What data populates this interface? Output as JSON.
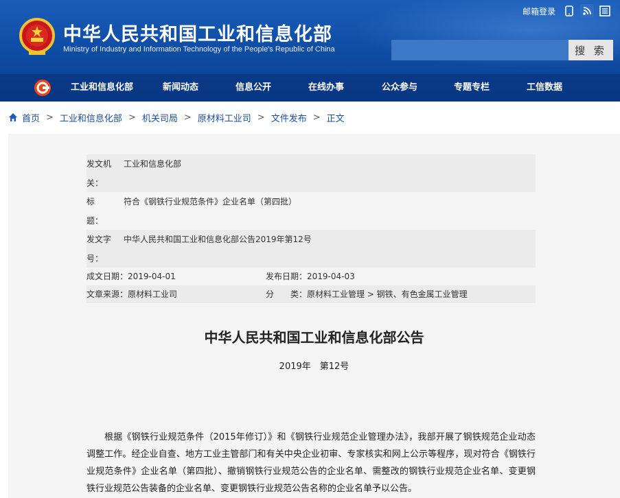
{
  "header": {
    "title": "中华人民共和国工业和信息化部",
    "subtitle": "Ministry of Industry and Information Technology of the People's Republic of China",
    "mail_login": "邮箱登录",
    "search": {
      "placeholder": "",
      "button": "搜 索"
    },
    "icons": [
      "mobile-icon",
      "rss-icon",
      "news-icon"
    ]
  },
  "nav": {
    "items": [
      "工业和信息化部",
      "新闻动态",
      "信息公开",
      "在线办事",
      "公众参与",
      "专题专栏",
      "工信数据"
    ]
  },
  "breadcrumb": {
    "items": [
      "首页",
      "工业和信息化部",
      "机关司局",
      "原材料工业司",
      "文件发布",
      "正文"
    ],
    "separator": ">"
  },
  "meta": {
    "issuer_label": "发文机关：",
    "issuer": "工业和信息化部",
    "title_label": "标　　题：",
    "title": "符合《钢铁行业规范条件》企业名单（第四批）",
    "docno_label": "发文字号：",
    "docno": "中华人民共和国工业和信息化部公告2019年第12号",
    "created": "成文日期：2019-04-01",
    "published": "发布日期：2019-04-03",
    "source": "文章来源：原材料工业司",
    "category_label": "分　　类：",
    "category": "原材料工业管理 > 钢铁、有色金属工业管理"
  },
  "document": {
    "title": "中华人民共和国工业和信息化部公告",
    "number": "2019年　第12号",
    "body": "根据《钢铁行业规范条件（2015年修订）》和《钢铁行业规范企业管理办法》，我部开展了钢铁规范企业动态调整工作。经企业自查、地方工业主管部门和有关中央企业初审、专家核实和网上公示等程序，现对符合《钢铁行业规范条件》企业名单（第四批）、撤销钢铁行业规范公告的企业名单、需整改的钢铁行业规范企业名单、变更钢铁行业规范公告装备的企业名单、变更钢铁行业规范公告名称的企业名单予以公告。"
  },
  "colors": {
    "header_blue": "#0f4ea6",
    "link_blue": "#1a4e9e",
    "content_bg": "#f5f5f5"
  }
}
